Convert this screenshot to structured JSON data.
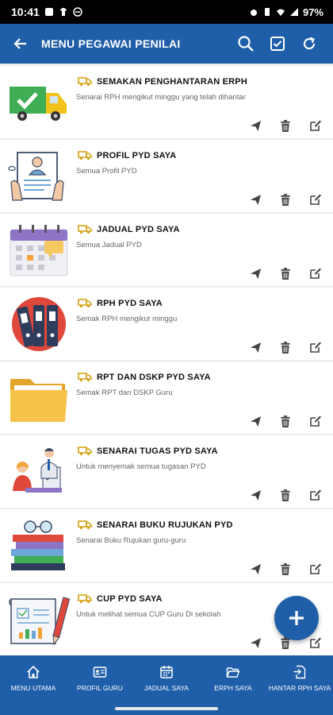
{
  "status": {
    "time": "10:41",
    "battery": "97%"
  },
  "appbar": {
    "title": "MENU PEGAWAI PENILAI"
  },
  "colors": {
    "primary": "#1f5ea8",
    "truck": "#d4a417"
  },
  "items": [
    {
      "title": "SEMAKAN PENGHANTARAN ERPH",
      "subtitle": "Senarai RPH mengikut minggu yang telah dihantar",
      "icon": "delivery-truck-check-icon"
    },
    {
      "title": "PROFIL PYD SAYA",
      "subtitle": "Semua Profil PYD",
      "icon": "profile-document-icon"
    },
    {
      "title": "JADUAL PYD SAYA",
      "subtitle": "Semua Jadual PYD",
      "icon": "calendar-icon"
    },
    {
      "title": "RPH PYD SAYA",
      "subtitle": "Semak RPH mengikut minggu",
      "icon": "binders-icon"
    },
    {
      "title": "RPT DAN DSKP PYD SAYA",
      "subtitle": "Semak RPT dan DSKP Guru",
      "icon": "folder-icon"
    },
    {
      "title": "SENARAI TUGAS PYD SAYA",
      "subtitle": "Untuk menyemak semua tugasan PYD",
      "icon": "teacher-student-icon"
    },
    {
      "title": "SENARAI BUKU RUJUKAN PYD",
      "subtitle": "Senarai Buku Rujukan guru-guru",
      "icon": "book-stack-icon"
    },
    {
      "title": "CUP PYD SAYA",
      "subtitle": "Untuk melihat semua CUP Guru Di sekolah",
      "icon": "blueprint-pencil-icon"
    }
  ],
  "bottom_nav": [
    {
      "label": "MENU UTAMA",
      "icon": "home-icon"
    },
    {
      "label": "PROFIL GURU",
      "icon": "id-card-icon"
    },
    {
      "label": "JADUAL SAYA",
      "icon": "calendar-icon"
    },
    {
      "label": "ERPH SAYA",
      "icon": "folder-open-icon"
    },
    {
      "label": "HANTAR RPH SAYA",
      "icon": "send-document-icon"
    }
  ]
}
